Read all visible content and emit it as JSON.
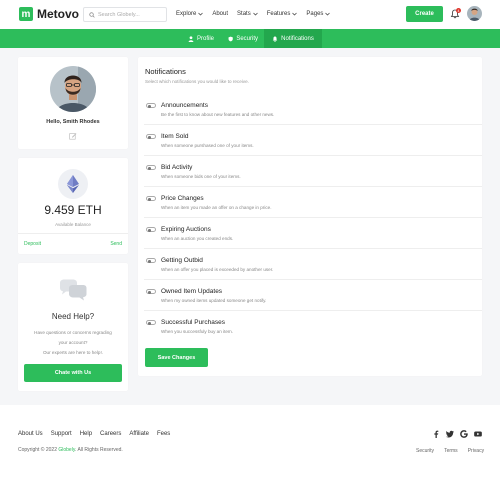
{
  "header": {
    "logo_letter": "m",
    "logo_text": "Metovo",
    "search_placeholder": "Search Globely...",
    "nav": [
      {
        "label": "Explore",
        "has_menu": true
      },
      {
        "label": "About",
        "has_menu": false
      },
      {
        "label": "Stats",
        "has_menu": true
      },
      {
        "label": "Features",
        "has_menu": true
      },
      {
        "label": "Pages",
        "has_menu": true
      }
    ],
    "create_label": "Create",
    "notification_count": "4",
    "accent_color": "#2dbd5b"
  },
  "tabs": [
    {
      "label": "Profile",
      "icon": "user-icon",
      "active": false
    },
    {
      "label": "Security",
      "icon": "shield-icon",
      "active": false
    },
    {
      "label": "Notifications",
      "icon": "bell-icon",
      "active": true
    }
  ],
  "profile": {
    "greeting": "Hello, Smith Rhodes"
  },
  "wallet": {
    "amount": "9.459 ETH",
    "label": "Available Balance",
    "deposit_label": "Deposit",
    "send_label": "Send"
  },
  "help": {
    "title": "Need Help?",
    "text_line1": "Have questions or concerns regrading",
    "text_line2": "your account?",
    "text_line3": "Our experts are here to help!.",
    "button_label": "Chate with Us"
  },
  "notifications": {
    "title": "Notifications",
    "subtitle": "Select which notifications you would like to receive.",
    "items": [
      {
        "title": "Announcements",
        "desc": "Be the first to know about new features and other news."
      },
      {
        "title": "Item Sold",
        "desc": "When someone purshased one of your items."
      },
      {
        "title": "Bid Activity",
        "desc": "When someone bids one of your items."
      },
      {
        "title": "Price Changes",
        "desc": "When an item you made an offer on a change in price."
      },
      {
        "title": "Expiring Auctions",
        "desc": "When an auction you created ends."
      },
      {
        "title": "Getting Outbid",
        "desc": "When an offer you placed is exceeded by another user."
      },
      {
        "title": "Owned Item Updates",
        "desc": "When my owned items updated someone get notify."
      },
      {
        "title": "Successful Purchases",
        "desc": "When you successfuly buy an item."
      }
    ],
    "save_label": "Save Changes"
  },
  "footer": {
    "links": [
      "About Us",
      "Support",
      "Help",
      "Careers",
      "Affiliate",
      "Fees"
    ],
    "copyright_prefix": "Copyright © 2022",
    "copyright_brand": "Globely",
    "copyright_suffix": ". All Rights Reserved.",
    "legal": [
      "Security",
      "Terms",
      "Privacy"
    ],
    "socials": [
      "facebook-icon",
      "twitter-icon",
      "google-icon",
      "youtube-icon"
    ]
  }
}
